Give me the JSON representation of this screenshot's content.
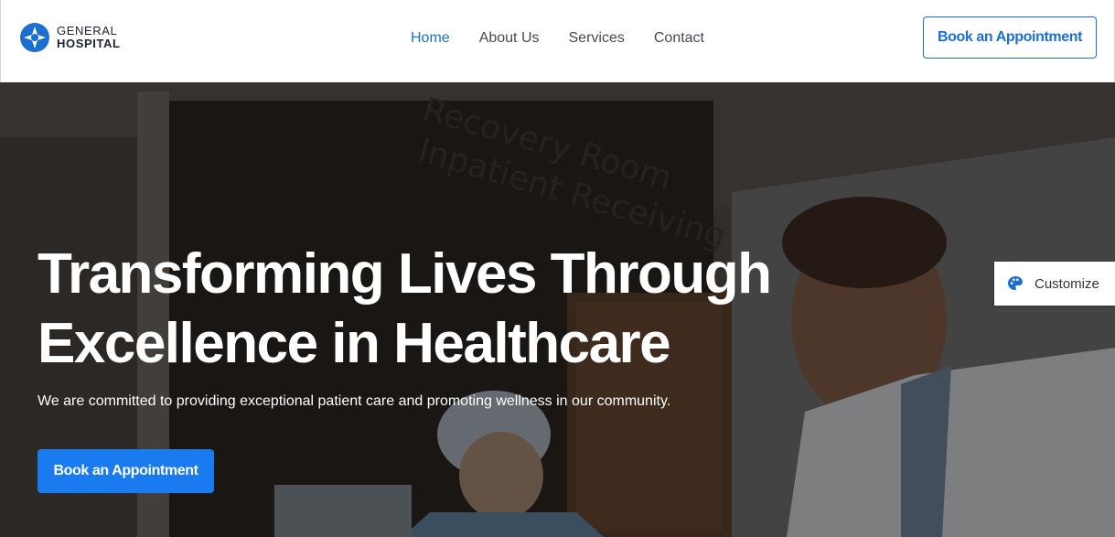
{
  "brand": {
    "name_line1": "GENERAL",
    "name_line2": "HOSPITAL",
    "icon": "hospital-star-logo-icon",
    "accent_color": "#1b6fd1"
  },
  "nav": {
    "items": [
      {
        "label": "Home",
        "active": true
      },
      {
        "label": "About Us",
        "active": false
      },
      {
        "label": "Services",
        "active": false
      },
      {
        "label": "Contact",
        "active": false
      }
    ]
  },
  "header": {
    "cta_label": "Book an Appointment"
  },
  "hero": {
    "title_line1": "Transforming Lives Through",
    "title_line2": "Excellence in Healthcare",
    "subtitle": "We are committed to providing exceptional patient care and promoting wellness in our community.",
    "cta_label": "Book an Appointment",
    "cta_color": "#1a7af0",
    "sign_line1": "Recovery Room",
    "sign_line2": "Inpatient Receiving"
  },
  "customize": {
    "label": "Customize",
    "icon": "palette-icon"
  }
}
